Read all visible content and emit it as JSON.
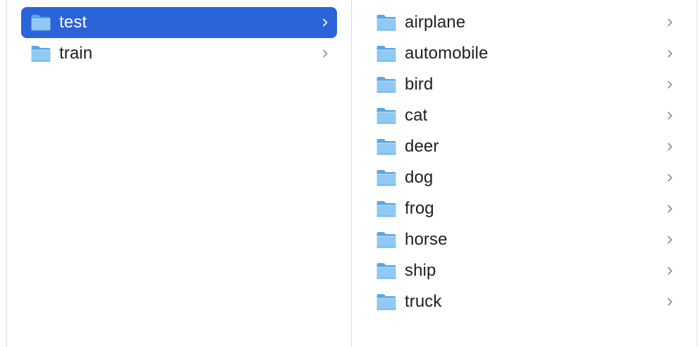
{
  "columns": [
    {
      "items": [
        {
          "label": "test",
          "selected": true
        },
        {
          "label": "train",
          "selected": false
        }
      ]
    },
    {
      "items": [
        {
          "label": "airplane",
          "selected": false
        },
        {
          "label": "automobile",
          "selected": false
        },
        {
          "label": "bird",
          "selected": false
        },
        {
          "label": "cat",
          "selected": false
        },
        {
          "label": "deer",
          "selected": false
        },
        {
          "label": "dog",
          "selected": false
        },
        {
          "label": "frog",
          "selected": false
        },
        {
          "label": "horse",
          "selected": false
        },
        {
          "label": "ship",
          "selected": false
        },
        {
          "label": "truck",
          "selected": false
        }
      ]
    }
  ],
  "icons": {
    "folder": "folder-icon",
    "disclosure": "chevron-right-icon"
  },
  "colors": {
    "selection": "#2b63d9",
    "folder_body": "#8fc9f4",
    "folder_tab": "#5aa6e6",
    "chevron": "#8e8e8e",
    "chevron_selected": "#ffffff"
  }
}
